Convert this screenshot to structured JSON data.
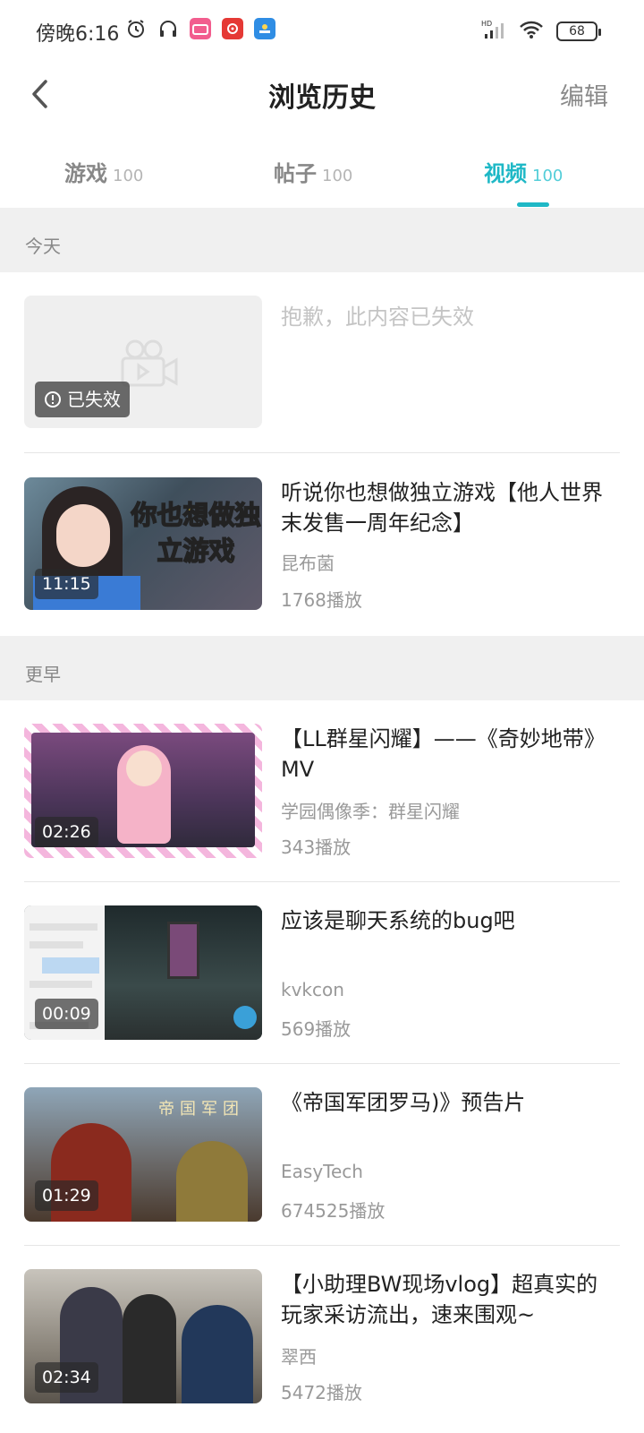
{
  "status_bar": {
    "time": "傍晚6:16",
    "battery": "68",
    "network": "HD"
  },
  "header": {
    "title": "浏览历史",
    "edit_label": "编辑"
  },
  "tabs": [
    {
      "label": "游戏",
      "count": "100"
    },
    {
      "label": "帖子",
      "count": "100"
    },
    {
      "label": "视频",
      "count": "100",
      "active": true
    }
  ],
  "sections": {
    "today": "今天",
    "earlier": "更早"
  },
  "invalid_item": {
    "message": "抱歉，此内容已失效",
    "badge": "已失效"
  },
  "videos": [
    {
      "title": "听说你也想做独立游戏【他人世界末发售一周年纪念】",
      "author": "昆布菌",
      "plays": "1768播放",
      "duration": "11:15",
      "overlay_text": "你也想做独立游戏"
    },
    {
      "title": "【LL群星闪耀】——《奇妙地带》MV",
      "author": "学园偶像季：群星闪耀",
      "plays": "343播放",
      "duration": "02:26"
    },
    {
      "title": "应该是聊天系统的bug吧",
      "author": "kvkcon",
      "plays": "569播放",
      "duration": "00:09"
    },
    {
      "title": "《帝国军团罗马)》预告片",
      "author": "EasyTech",
      "plays": "674525播放",
      "duration": "01:29",
      "overlay_text": "帝国军团"
    },
    {
      "title": "【小助理BW现场vlog】超真实的玩家采访流出，速来围观~",
      "author": "翠西",
      "plays": "5472播放",
      "duration": "02:34"
    }
  ],
  "colors": {
    "accent": "#1fb8c6",
    "section_bg": "#f0f0f0",
    "muted_text": "#999999"
  }
}
